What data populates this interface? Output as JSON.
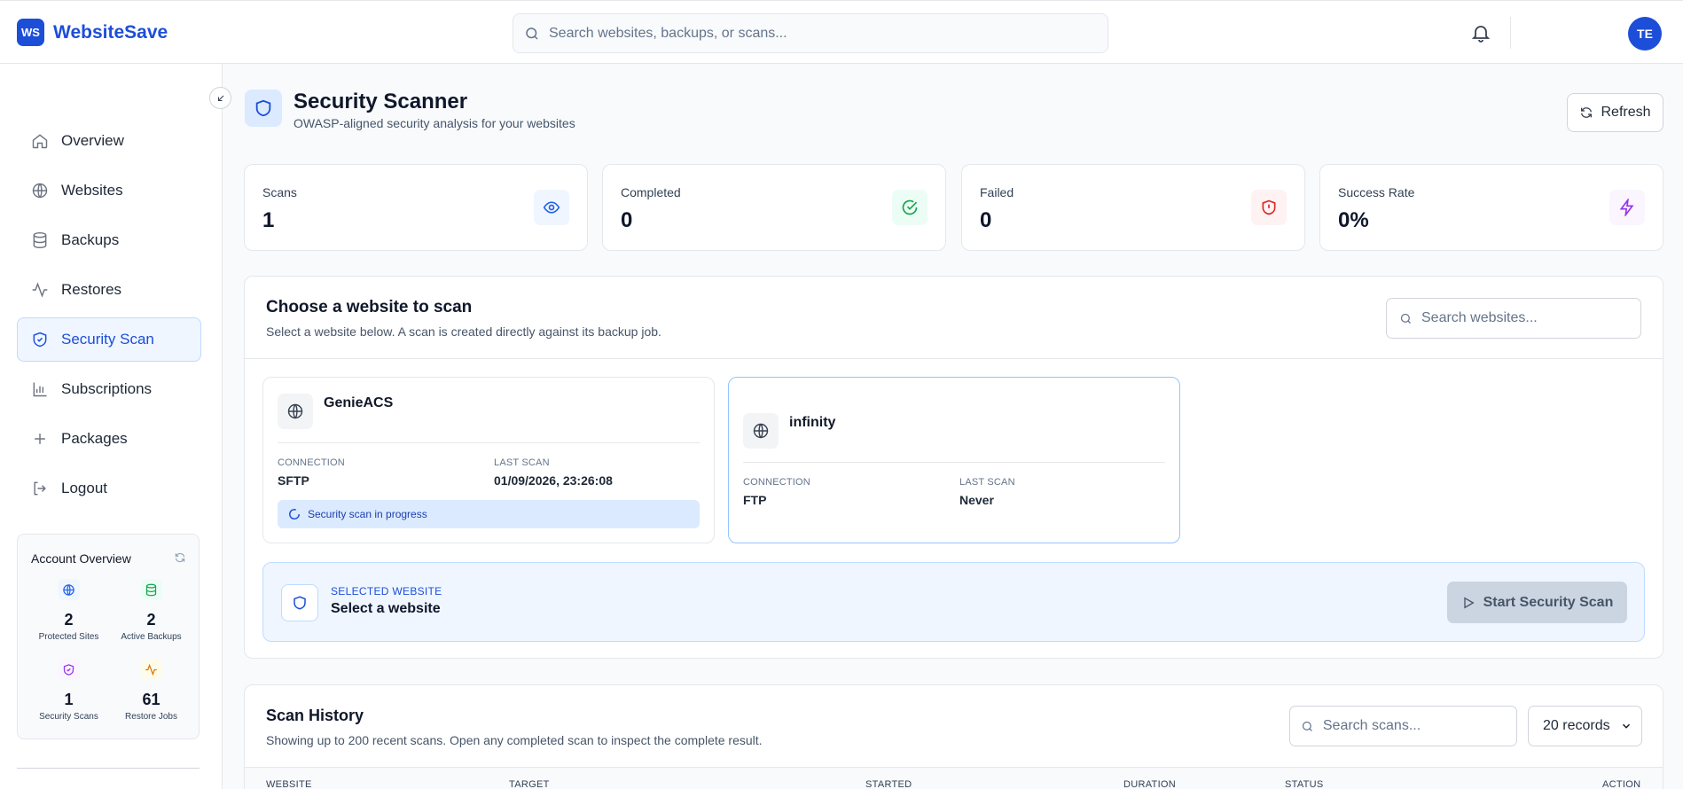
{
  "app": {
    "logo_mark": "WS",
    "name": "WebsiteSave",
    "search_placeholder": "Search websites, backups, or scans...",
    "user_initials": "TE"
  },
  "sidebar": {
    "items": [
      {
        "label": "Overview",
        "icon": "home-icon"
      },
      {
        "label": "Websites",
        "icon": "globe-icon"
      },
      {
        "label": "Backups",
        "icon": "database-icon"
      },
      {
        "label": "Restores",
        "icon": "activity-icon"
      },
      {
        "label": "Security Scan",
        "icon": "shield-check-icon",
        "active": true
      },
      {
        "label": "Subscriptions",
        "icon": "bar-chart-icon"
      },
      {
        "label": "Packages",
        "icon": "plus-icon"
      },
      {
        "label": "Logout",
        "icon": "logout-icon"
      }
    ],
    "account": {
      "title": "Account Overview",
      "stats": [
        {
          "value": "2",
          "label": "Protected Sites",
          "icon": "globe-icon"
        },
        {
          "value": "2",
          "label": "Active Backups",
          "icon": "database-icon"
        },
        {
          "value": "1",
          "label": "Security Scans",
          "icon": "shield-check-icon"
        },
        {
          "value": "61",
          "label": "Restore Jobs",
          "icon": "activity-icon"
        }
      ]
    }
  },
  "page": {
    "title": "Security Scanner",
    "subtitle": "OWASP-aligned security analysis for your websites",
    "refresh_label": "Refresh"
  },
  "stats": [
    {
      "label": "Scans",
      "value": "1",
      "icon": "eye-icon",
      "color": "#2563eb",
      "bg": "#eff6ff"
    },
    {
      "label": "Completed",
      "value": "0",
      "icon": "check-circle-icon",
      "color": "#16a34a",
      "bg": "#ecfdf5"
    },
    {
      "label": "Failed",
      "value": "0",
      "icon": "shield-alert-icon",
      "color": "#dc2626",
      "bg": "#fef2f2"
    },
    {
      "label": "Success Rate",
      "value": "0%",
      "icon": "zap-icon",
      "color": "#9333ea",
      "bg": "#faf5ff"
    }
  ],
  "chooser": {
    "title": "Choose a website to scan",
    "subtitle": "Select a website below. A scan is created directly against its backup job.",
    "search_placeholder": "Search websites...",
    "sites": [
      {
        "name": "GenieACS",
        "connection_label": "CONNECTION",
        "connection": "SFTP",
        "last_scan_label": "LAST SCAN",
        "last_scan": "01/09/2026, 23:26:08",
        "status": "Security scan in progress"
      },
      {
        "name": "infinity",
        "connection_label": "CONNECTION",
        "connection": "FTP",
        "last_scan_label": "LAST SCAN",
        "last_scan": "Never"
      }
    ],
    "selected_label": "SELECTED WEBSITE",
    "selected_value": "Select a website",
    "start_label": "Start Security Scan"
  },
  "history": {
    "title": "Scan History",
    "subtitle": "Showing up to 200 recent scans. Open any completed scan to inspect the complete result.",
    "search_placeholder": "Search scans...",
    "records": "20 records",
    "columns": [
      "WEBSITE",
      "TARGET",
      "STARTED",
      "DURATION",
      "STATUS",
      "ACTION"
    ]
  }
}
